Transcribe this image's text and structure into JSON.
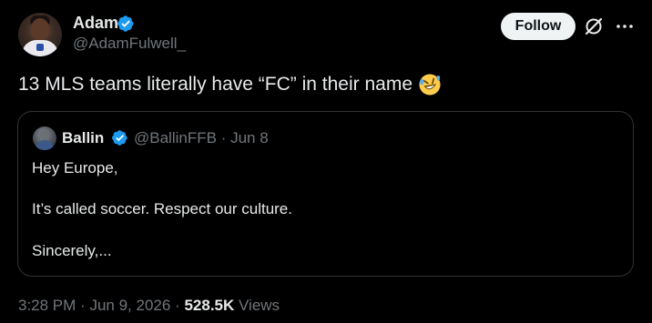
{
  "tweet": {
    "author": {
      "display_name": "Adam",
      "handle": "@AdamFulwell_",
      "verified": true
    },
    "actions": {
      "follow_label": "Follow",
      "grok_icon": "grok-slash-circle-icon",
      "more_icon": "more-dots-icon"
    },
    "text": "13 MLS teams literally have “FC” in their name",
    "emoji": "🤣",
    "quote": {
      "display_name": "Ballin",
      "handle": "@BallinFFB",
      "separator": "·",
      "date": "Jun 8",
      "verified": true,
      "lines": [
        "Hey Europe,",
        "It’s called soccer. Respect our culture.",
        "Sincerely,..."
      ]
    },
    "footer": {
      "time": "3:28 PM",
      "sep1": "·",
      "date": "Jun 9, 2026",
      "sep2": "·",
      "views_count": "528.5K",
      "views_label": "Views"
    }
  },
  "colors": {
    "background": "#000000",
    "text_primary": "#e7e9ea",
    "text_secondary": "#71767b",
    "verified_blue": "#1d9bf0",
    "border": "#2f3336",
    "follow_bg": "#eff3f4"
  }
}
